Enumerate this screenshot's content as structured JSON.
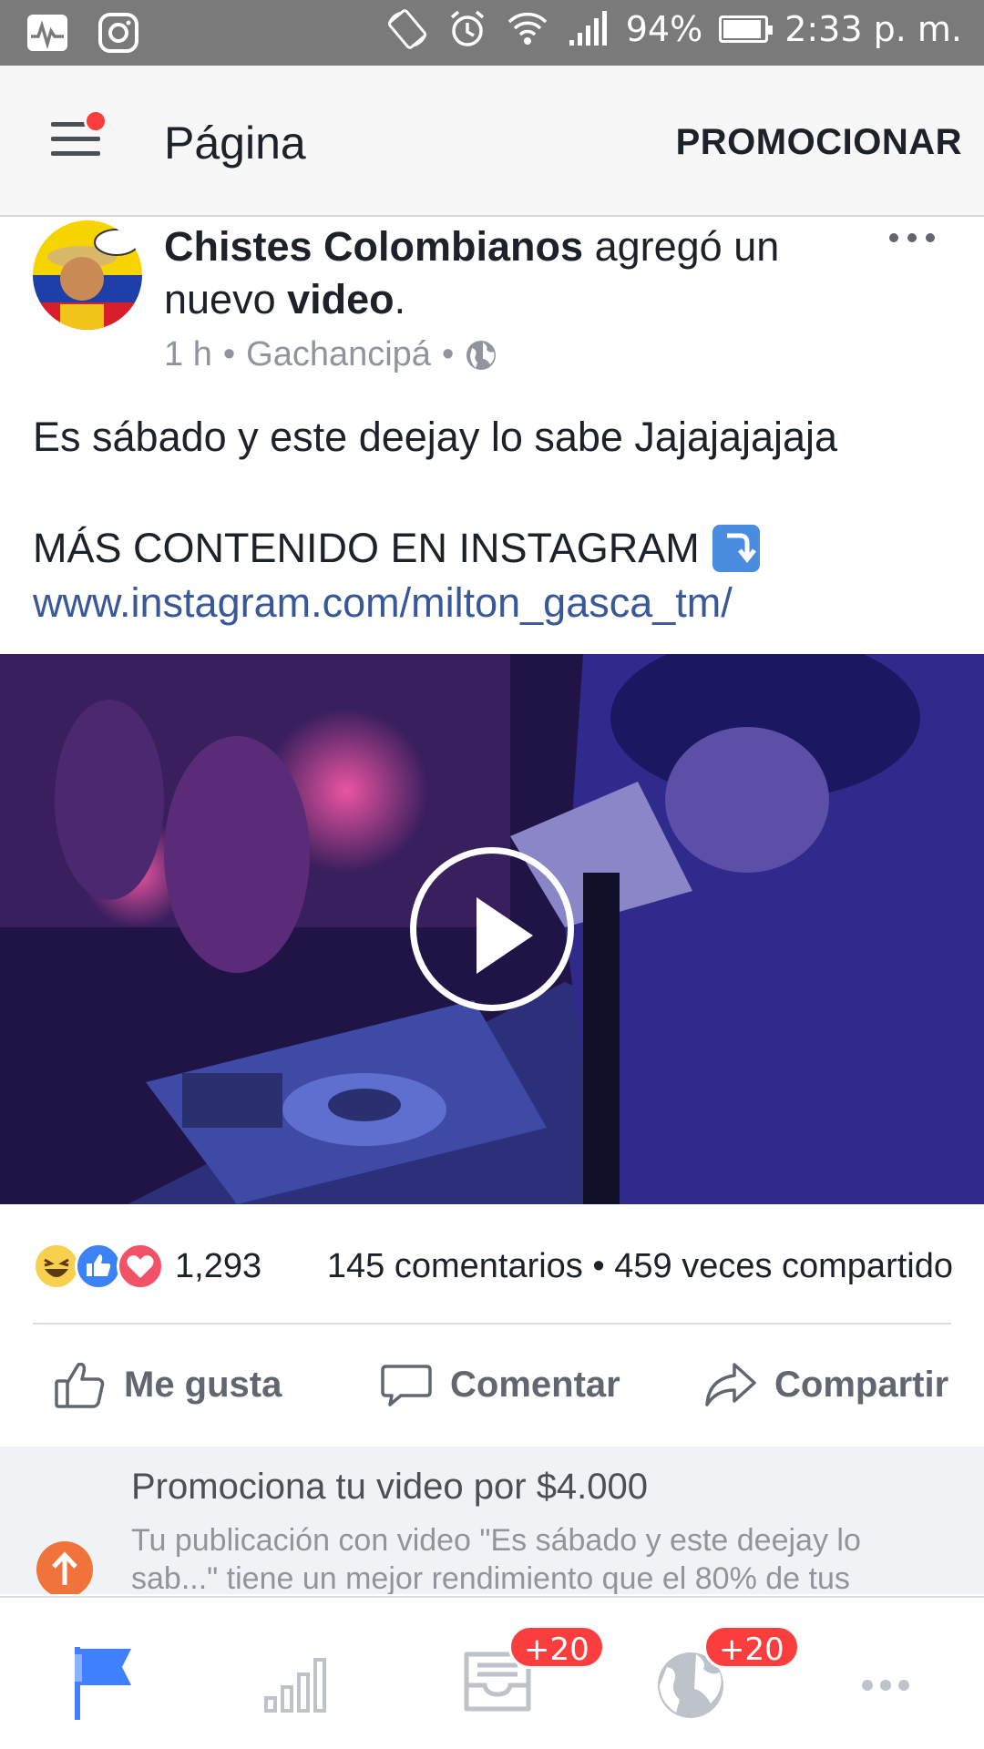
{
  "status_bar": {
    "battery": "94%",
    "battery_level": 0.94,
    "time": "2:33 p. m.",
    "icons": [
      "activity-icon",
      "instagram-icon",
      "rotate-icon",
      "alarm-icon",
      "wifi-icon",
      "signal-icon",
      "battery-icon"
    ]
  },
  "header": {
    "title": "Página",
    "promote_label": "PROMOCIONAR"
  },
  "post": {
    "author": "Chistes Colombianos",
    "action_text": " agregó un nuevo ",
    "action_bold": "video",
    "action_end": ".",
    "time": "1 h",
    "location": "Gachancipá",
    "text_line1": "Es sábado y este deejay lo sabe Jajajajajaja",
    "text_line2": "MÁS CONTENIDO EN INSTAGRAM",
    "link": "www.instagram.com/milton_gasca_tm/"
  },
  "reactions": {
    "count": "1,293",
    "engagement": "145 comentarios • 459 veces compartido",
    "types": [
      "haha-icon",
      "like-icon",
      "love-icon"
    ]
  },
  "actions": {
    "like": "Me gusta",
    "comment": "Comentar",
    "share": "Compartir"
  },
  "promo": {
    "title": "Promociona tu video por $4.000",
    "description": "Tu publicación con video  \"Es sábado y este deejay lo sab...\" tiene un mejor rendimiento que el 80% de tus"
  },
  "bottom_nav": {
    "inbox_badge": "+20",
    "notifications_badge": "+20",
    "active_color": "#4080ff",
    "inactive_color": "#bec2c9"
  }
}
